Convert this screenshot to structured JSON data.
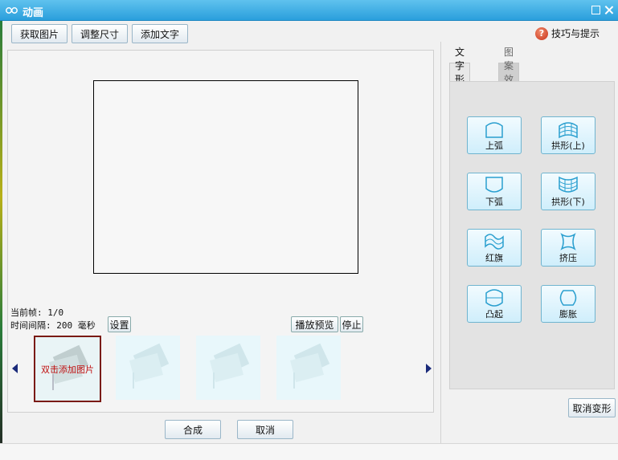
{
  "window": {
    "title": "动画"
  },
  "toolbar": {
    "get_image": "获取图片",
    "resize": "调整尺寸",
    "add_text": "添加文字"
  },
  "tips": {
    "label": "技巧与提示",
    "icon": "?"
  },
  "frame_info": {
    "current_frame_label": "当前帧:",
    "current_frame_value": "1/0",
    "interval_label": "时间间隔:",
    "interval_value": "200",
    "interval_unit": "毫秒",
    "settings_button": "设置"
  },
  "playback": {
    "preview": "播放预览",
    "stop": "停止"
  },
  "thumbnails": {
    "add_image_label": "双击添加图片"
  },
  "actions": {
    "compose": "合成",
    "cancel": "取消"
  },
  "tabs": {
    "text_shape": "文字形状",
    "pattern_effect": "图案效果"
  },
  "shapes": {
    "upper_arc": "上弧",
    "arch_up": "拱形(上)",
    "lower_arc": "下弧",
    "arch_down": "拱形(下)",
    "flag": "红旗",
    "squeeze": "挤压",
    "bulge": "凸起",
    "inflate": "膨胀"
  },
  "cancel_warp": "取消变形",
  "colors": {
    "title_bar": "#2a9fdc",
    "shape_border": "#6fb4cf",
    "thumb_label": "#c01010"
  }
}
